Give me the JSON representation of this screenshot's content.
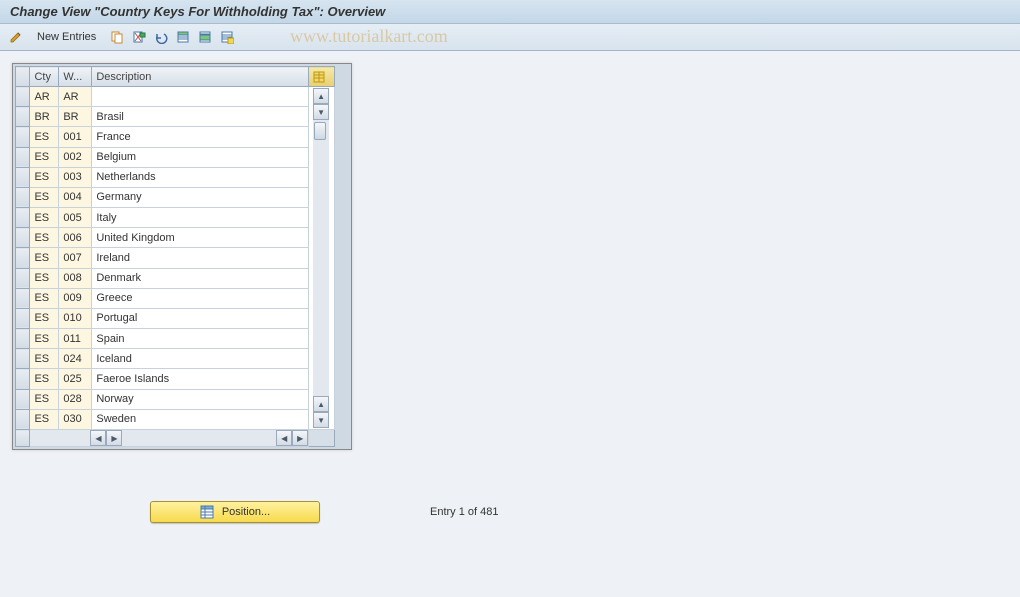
{
  "title": "Change View \"Country Keys For Withholding Tax\": Overview",
  "watermark": "www.tutorialkart.com",
  "toolbar": {
    "new_entries": "New Entries"
  },
  "columns": {
    "sel": "",
    "cty": "Cty",
    "w": "W...",
    "desc": "Description"
  },
  "rows": [
    {
      "cty": "AR",
      "w": "AR",
      "desc": ""
    },
    {
      "cty": "BR",
      "w": "BR",
      "desc": "Brasil"
    },
    {
      "cty": "ES",
      "w": "001",
      "desc": "France"
    },
    {
      "cty": "ES",
      "w": "002",
      "desc": "Belgium"
    },
    {
      "cty": "ES",
      "w": "003",
      "desc": "Netherlands"
    },
    {
      "cty": "ES",
      "w": "004",
      "desc": "Germany"
    },
    {
      "cty": "ES",
      "w": "005",
      "desc": "Italy"
    },
    {
      "cty": "ES",
      "w": "006",
      "desc": "United Kingdom"
    },
    {
      "cty": "ES",
      "w": "007",
      "desc": "Ireland"
    },
    {
      "cty": "ES",
      "w": "008",
      "desc": "Denmark"
    },
    {
      "cty": "ES",
      "w": "009",
      "desc": "Greece"
    },
    {
      "cty": "ES",
      "w": "010",
      "desc": "Portugal"
    },
    {
      "cty": "ES",
      "w": "011",
      "desc": "Spain"
    },
    {
      "cty": "ES",
      "w": "024",
      "desc": "Iceland"
    },
    {
      "cty": "ES",
      "w": "025",
      "desc": "Faeroe Islands"
    },
    {
      "cty": "ES",
      "w": "028",
      "desc": "Norway"
    },
    {
      "cty": "ES",
      "w": "030",
      "desc": "Sweden"
    }
  ],
  "position_button": "Position...",
  "status": "Entry 1 of 481"
}
